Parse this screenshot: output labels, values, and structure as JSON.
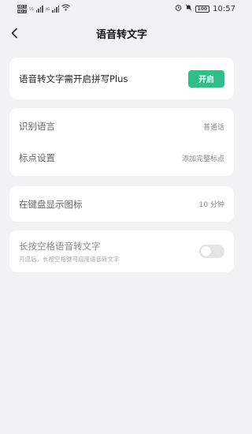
{
  "status_bar": {
    "sim1": "HD 1",
    "sim2": "HD 2",
    "net1": "5G",
    "net2": "4G",
    "battery": "100",
    "time": "10:57"
  },
  "header": {
    "title": "语音转文字"
  },
  "plus_card": {
    "label": "语音转文字需开启拼写Plus",
    "button": "开启"
  },
  "settings_card": {
    "language_label": "识别语言",
    "language_value": "普通话",
    "punctuation_label": "标点设置",
    "punctuation_value": "添加完整标点"
  },
  "keyboard_icon_card": {
    "label": "在键盘显示图标",
    "value": "10 分钟"
  },
  "space_card": {
    "label": "长按空格语音转文字",
    "sublabel": "开启后，长按空格键可启用语音转文字",
    "enabled": false
  },
  "colors": {
    "accent": "#2dbf87",
    "background": "#f2f2f4"
  }
}
